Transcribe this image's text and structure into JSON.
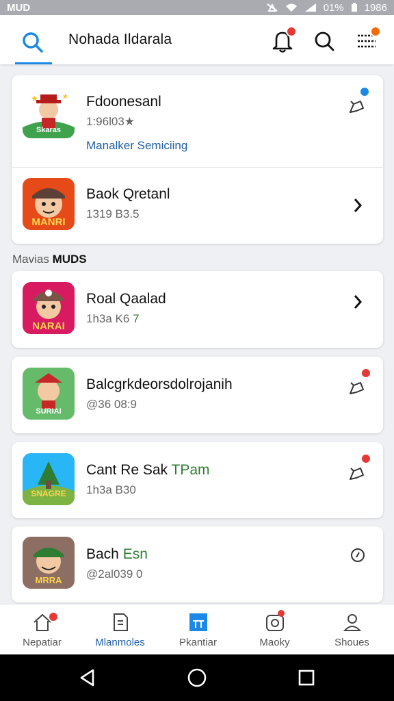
{
  "status_bar": {
    "left_text": "MUD",
    "battery_text": "01%",
    "time": "1986"
  },
  "header": {
    "title": "Nohada Ildarala",
    "colors": {
      "accent": "#1e88e5",
      "badge_red": "#e53935",
      "badge_orange": "#ef6c00"
    },
    "icons": [
      "search-icon",
      "bell-icon",
      "search-icon",
      "menu-list-icon"
    ]
  },
  "top_card": {
    "items": [
      {
        "title": "Fdoonesanl",
        "subtitle": "1:96l03★",
        "link": "Manalker Semiciing",
        "action_icon": "pin-icon"
      },
      {
        "title": "Baok Qretanl",
        "subtitle": "1319 B3.5",
        "action_icon": "chevron-right-icon"
      }
    ]
  },
  "section": {
    "prefix": "Mavias",
    "emphasis": "MUDS"
  },
  "list": [
    {
      "title": "Roal Qaalad",
      "subtitle_main": "1h3a K6",
      "subtitle_accent": "7",
      "action_icon": "chevron-right-icon",
      "thumb_text": "NARAI"
    },
    {
      "title": "Balcgrkdeorsdolroj",
      "title_accent": "anih",
      "subtitle_main": "@36 08:9",
      "action_icon": "pin-icon",
      "thumb_text": "SURIAI"
    },
    {
      "title": "Cant Re Sak ",
      "title_accent": "TPam",
      "subtitle_main": "1h3a B30",
      "action_icon": "pin-icon",
      "thumb_text": "SNAGRE"
    },
    {
      "title": "Bach ",
      "title_accent": "Esn",
      "subtitle_main": "@2al039 0",
      "action_icon": "clock-icon",
      "thumb_text": "MRRA"
    }
  ],
  "top_thumbs": [
    "Skaras",
    "MANRI"
  ],
  "bottom_nav": [
    {
      "label": "Nepatiar",
      "icon": "home-icon"
    },
    {
      "label": "Mlanmoles",
      "icon": "document-icon",
      "active": true
    },
    {
      "label": "Pkantiar",
      "icon": "calendar-icon"
    },
    {
      "label": "Maoky",
      "icon": "camera-icon"
    },
    {
      "label": "Shoues",
      "icon": "user-icon"
    }
  ]
}
